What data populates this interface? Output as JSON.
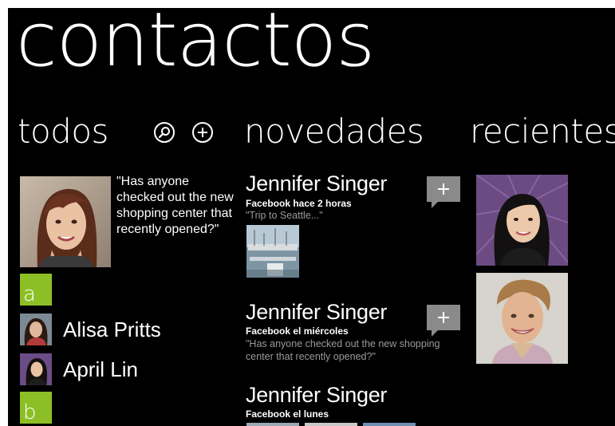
{
  "app": {
    "title": "contactos"
  },
  "sections": {
    "todos": "todos",
    "novedades": "novedades",
    "recientes": "recientes"
  },
  "icons": {
    "search": "search-icon",
    "add": "add-icon",
    "comment": "comment-plus-icon"
  },
  "todos": {
    "featured_quote": "\"Has anyone checked out the new shopping center that recently opened?\"",
    "groups": [
      {
        "letter": "a",
        "contacts": [
          "Alisa Pritts",
          "April Lin"
        ]
      },
      {
        "letter": "b",
        "contacts": []
      }
    ]
  },
  "novedades": {
    "items": [
      {
        "name": "Jennifer Singer",
        "source": "Facebook hace 2 horas",
        "text": "\"Trip to Seattle...\""
      },
      {
        "name": "Jennifer Singer",
        "source": "Facebook el miércoles",
        "text": "\"Has anyone checked out the new shopping center that recently opened?\""
      },
      {
        "name": "Jennifer Singer",
        "source": "Facebook el lunes",
        "text": ""
      }
    ]
  },
  "colors": {
    "background": "#000000",
    "accent": "#8cbf26",
    "comment_tile": "#8a8a8a",
    "secondary_text": "#9a9a9a"
  }
}
